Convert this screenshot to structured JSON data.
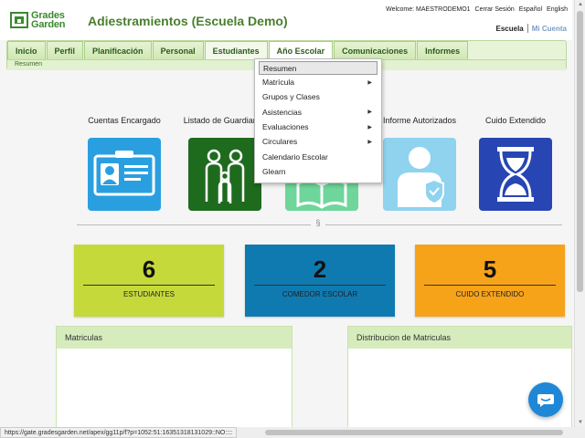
{
  "header": {
    "logo_line1": "Grades",
    "logo_line2": "Garden",
    "title": "Adiestramientos (Escuela Demo)",
    "welcome": "Welcome: MAESTRODEMO1",
    "logout": "Cerrar Sesión",
    "lang_es": "Español",
    "lang_en": "English",
    "school": "Escuela",
    "my_account": "Mi Cuenta"
  },
  "nav": {
    "tabs": [
      "Inicio",
      "Perfil",
      "Planificación",
      "Personal",
      "Estudiantes",
      "Año Escolar",
      "Comunicaciones",
      "Informes"
    ],
    "active_tab": "Estudiantes",
    "breadcrumb": "Resumen"
  },
  "dropdown": {
    "items": [
      {
        "label": "Resumen",
        "submenu": false
      },
      {
        "label": "Matrícula",
        "submenu": true
      },
      {
        "label": "Grupos y Clases",
        "submenu": false
      },
      {
        "label": "Asistencias",
        "submenu": true
      },
      {
        "label": "Evaluaciones",
        "submenu": true
      },
      {
        "label": "Circulares",
        "submenu": true
      },
      {
        "label": "Calendario Escolar",
        "submenu": false
      },
      {
        "label": "Glearn",
        "submenu": false
      }
    ]
  },
  "cards": [
    {
      "label": "Cuentas Encargado",
      "icon": "id-card-icon",
      "color": "#2a9fe0"
    },
    {
      "label": "Listado de Guardianes",
      "icon": "family-icon",
      "color": "#1e6b1e"
    },
    {
      "label": "",
      "icon": "book-icon",
      "color": "#6ed69a"
    },
    {
      "label": "Informe Autorizados",
      "icon": "person-shield-icon",
      "color": "#8fd3ef"
    },
    {
      "label": "Cuido Extendido",
      "icon": "hourglass-icon",
      "color": "#2746b4"
    }
  ],
  "divider_mark": "§",
  "stats": [
    {
      "value": "6",
      "label": "ESTUDIANTES",
      "color": "#c6d93b"
    },
    {
      "value": "2",
      "label": "COMEDOR ESCOLAR",
      "color": "#0f7ab0"
    },
    {
      "value": "5",
      "label": "CUIDO EXTENDIDO",
      "color": "#f6a31a"
    }
  ],
  "panels": {
    "left": "Matriculas",
    "right": "Distribucion de Matriculas"
  },
  "status_url": "https://gate.gradesgarden.net/apex/gg11p/f?p=1052:51:16351318131029::NO::::"
}
